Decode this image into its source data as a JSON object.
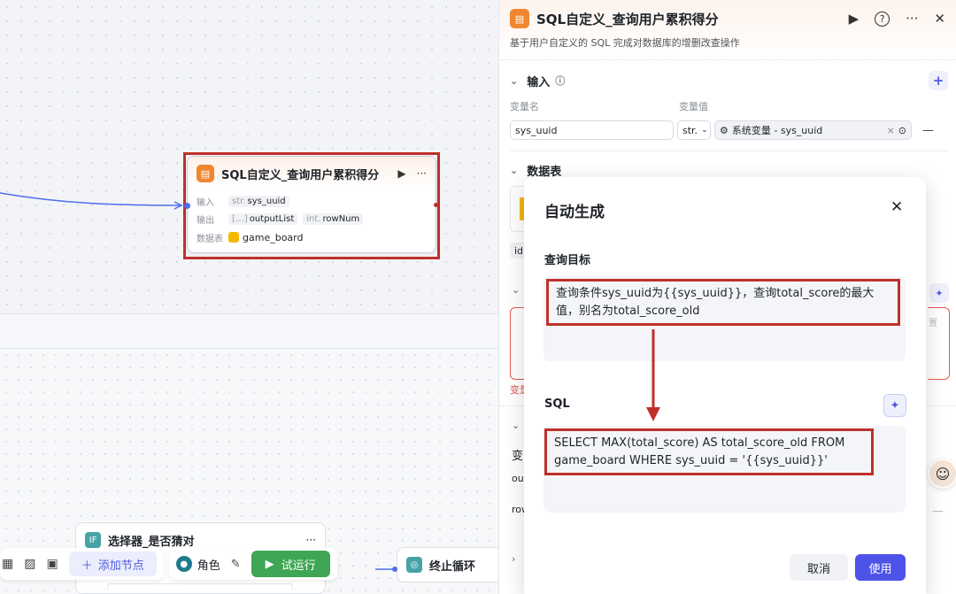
{
  "canvas": {
    "node": {
      "title": "SQL自定义_查询用户累积得分",
      "run_icon": "▶",
      "more_icon": "···",
      "input_label": "输入",
      "input_type": "str.",
      "input_value": "sys_uuid",
      "output_label": "输出",
      "output_type1": "[…]",
      "output_value1": "outputList",
      "output_type2": "int.",
      "output_value2": "rowNum",
      "table_label": "数据表",
      "table_value": "game_board"
    },
    "selector_node": {
      "badge": "IF",
      "title": "选择器_是否猜对",
      "more": "···"
    },
    "end_node": {
      "title": "终止循环"
    }
  },
  "toolbar": {
    "add_node": "添加节点",
    "role": "角色",
    "run": "试运行"
  },
  "panel": {
    "title": "SQL自定义_查询用户累积得分",
    "description": "基于用户自定义的 SQL 完成对数据库的增删改查操作",
    "input_section": "输入",
    "col_var_name": "变量名",
    "col_var_value": "变量值",
    "var_name": "sys_uuid",
    "var_type": "str.",
    "var_value": "系统变量 - sys_uuid",
    "table_section": "数据表",
    "id_chip": "id",
    "partial_label": "变量",
    "partial_var": "变",
    "partial_out": "ou",
    "partial_row": "row",
    "partial_dash": "—",
    "partial_hint": "置"
  },
  "modal": {
    "title": "自动生成",
    "query_label": "查询目标",
    "query_text": "查询条件sys_uuid为{{sys_uuid}}，查询total_score的最大值，别名为total_score_old",
    "sql_label": "SQL",
    "sql_text": "SELECT MAX(total_score) AS total_score_old FROM game_board WHERE sys_uuid = '{{sys_uuid}}'",
    "cancel": "取消",
    "use": "使用"
  }
}
